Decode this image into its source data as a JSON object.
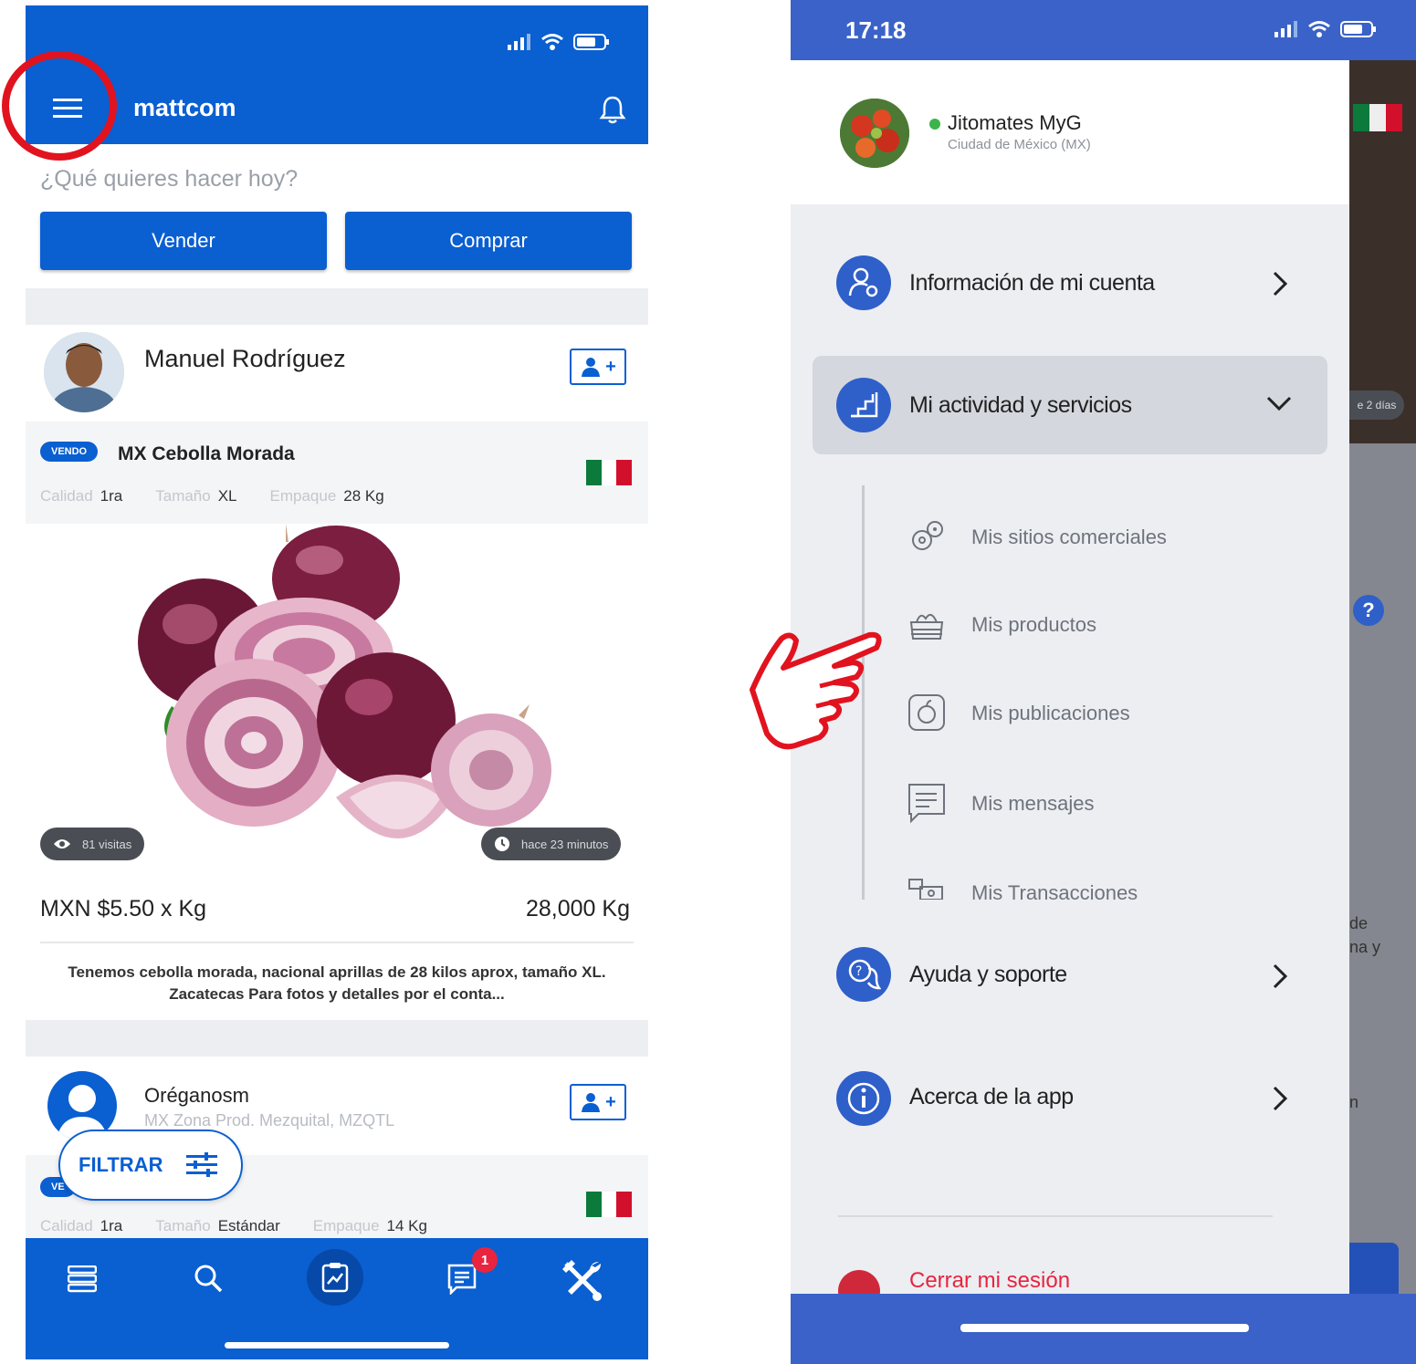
{
  "left_screen": {
    "app_title": "mattcom",
    "prompt": "¿Qué quieres hacer hoy?",
    "sell_button": "Vender",
    "buy_button": "Comprar",
    "post1": {
      "user": "Manuel Rodríguez",
      "badge": "VENDO",
      "product": "MX Cebolla Morada",
      "attr_quality_label": "Calidad",
      "attr_quality": "1ra",
      "attr_size_label": "Tamaño",
      "attr_size": "XL",
      "attr_pack_label": "Empaque",
      "attr_pack": "28 Kg",
      "visits": "81 visitas",
      "time": "hace 23 minutos",
      "price": "MXN $5.50 x Kg",
      "quantity": "28,000 Kg",
      "description": "Tenemos cebolla morada, nacional aprillas de 28 kilos aprox, tamaño XL. Zacatecas  Para fotos y detalles por el conta..."
    },
    "post2": {
      "user": "Oréganosm",
      "location": "MX Zona Prod. Mezquital, MZQTL",
      "badge": "VE",
      "attr_quality_label": "Calidad",
      "attr_quality": "1ra",
      "attr_size_label": "Tamaño",
      "attr_size": "Estándar",
      "attr_pack_label": "Empaque",
      "attr_pack": "14 Kg"
    },
    "filter_button": "FILTRAR",
    "notification_count": "1"
  },
  "right_screen": {
    "time": "17:18",
    "store_name": "Jitomates MyG",
    "store_location": "Ciudad de México (MX)",
    "menu": {
      "account": "Información de mi cuenta",
      "activity": "Mi actividad y servicios",
      "sub_items": [
        "Mis sitios comerciales",
        "Mis productos",
        "Mis publicaciones",
        "Mis mensajes",
        "Mis Transacciones"
      ],
      "help": "Ayuda y soporte",
      "about": "Acerca de la app",
      "logout": "Cerrar mi sesión"
    },
    "peek": {
      "days": "e 2 días",
      "de": "de",
      "nay": "na y",
      "n": "n"
    }
  },
  "colors": {
    "primary_blue": "#0a5fd1",
    "drawer_blue": "#3a62c8",
    "annotation_red": "#e1131f",
    "badge_red": "#e8243e"
  }
}
